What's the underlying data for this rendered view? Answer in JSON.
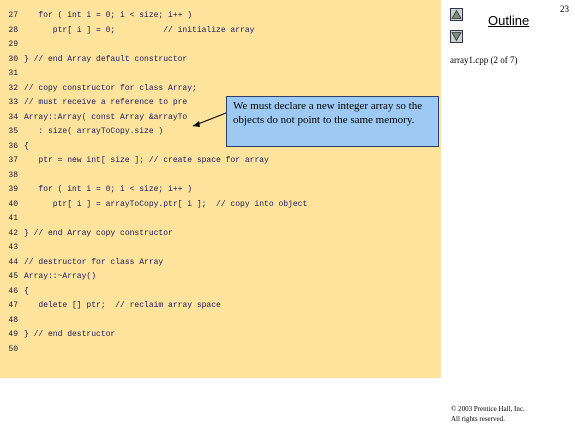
{
  "page_number": "23",
  "sidebar": {
    "outline_title": "Outline",
    "file_label": "array1.cpp (2 of 7)",
    "up_icon": "up-triangle-icon",
    "down_icon": "down-triangle-icon"
  },
  "code_lines": [
    {
      "num": "27",
      "text": "   for ( int i = 0; i < size; i++ )"
    },
    {
      "num": "28",
      "text": "      ptr[ i ] = 0;          // initialize array"
    },
    {
      "num": "29",
      "text": ""
    },
    {
      "num": "30",
      "text": "} // end Array default constructor"
    },
    {
      "num": "31",
      "text": ""
    },
    {
      "num": "32",
      "text": "// copy constructor for class Array;"
    },
    {
      "num": "33",
      "text": "// must receive a reference to pre"
    },
    {
      "num": "34",
      "text": "Array::Array( const Array &arrayTo"
    },
    {
      "num": "35",
      "text": "   : size( arrayToCopy.size )"
    },
    {
      "num": "36",
      "text": "{"
    },
    {
      "num": "37",
      "text": "   ptr = new int[ size ]; // create space for array"
    },
    {
      "num": "38",
      "text": ""
    },
    {
      "num": "39",
      "text": "   for ( int i = 0; i < size; i++ )"
    },
    {
      "num": "40",
      "text": "      ptr[ i ] = arrayToCopy.ptr[ i ];  // copy into object"
    },
    {
      "num": "41",
      "text": ""
    },
    {
      "num": "42",
      "text": "} // end Array copy constructor"
    },
    {
      "num": "43",
      "text": ""
    },
    {
      "num": "44",
      "text": "// destructor for class Array"
    },
    {
      "num": "45",
      "text": "Array::~Array()"
    },
    {
      "num": "46",
      "text": "{"
    },
    {
      "num": "47",
      "text": "   delete [] ptr;  // reclaim array space"
    },
    {
      "num": "48",
      "text": ""
    },
    {
      "num": "49",
      "text": "} // end destructor"
    },
    {
      "num": "50",
      "text": ""
    }
  ],
  "callout": {
    "text": "We must declare a new integer array so the objects do not point to the same memory."
  },
  "footer": {
    "line1": "© 2003 Prentice Hall, Inc.",
    "line2": "All rights reserved."
  },
  "colors": {
    "code_background": "#fde39c",
    "callout_background": "#9ec9f2"
  }
}
